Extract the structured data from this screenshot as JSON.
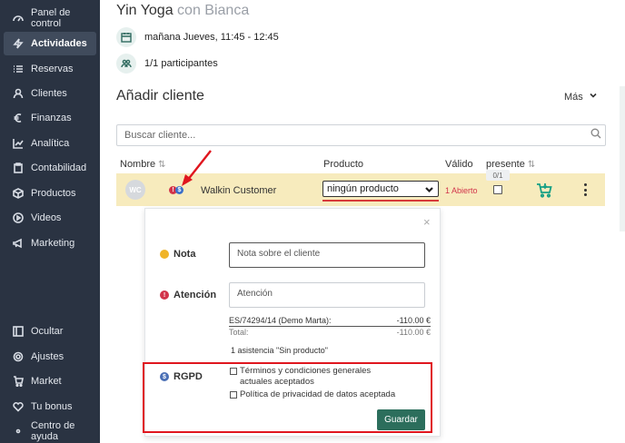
{
  "sidebar": {
    "items": [
      {
        "label": "Panel de control",
        "icon": "gauge-icon",
        "active": false
      },
      {
        "label": "Actividades",
        "icon": "bolt-icon",
        "active": true
      },
      {
        "label": "Reservas",
        "icon": "list-icon",
        "active": false
      },
      {
        "label": "Clientes",
        "icon": "person-icon",
        "active": false
      },
      {
        "label": "Finanzas",
        "icon": "euro-icon",
        "active": false
      },
      {
        "label": "Analítica",
        "icon": "chart-icon",
        "active": false
      },
      {
        "label": "Contabilidad",
        "icon": "clipboard-icon",
        "active": false
      },
      {
        "label": "Productos",
        "icon": "box-icon",
        "active": false
      },
      {
        "label": "Videos",
        "icon": "play-icon",
        "active": false
      },
      {
        "label": "Marketing",
        "icon": "megaphone-icon",
        "active": false
      }
    ],
    "bottom_items": [
      {
        "label": "Ocultar",
        "icon": "collapse-icon"
      },
      {
        "label": "Ajustes",
        "icon": "gear-icon"
      },
      {
        "label": "Market",
        "icon": "cart-icon"
      },
      {
        "label": "Tu bonus",
        "icon": "heart-icon"
      },
      {
        "label": "Centro de ayuda",
        "icon": "dot-icon"
      }
    ]
  },
  "activity": {
    "title": "Yin Yoga",
    "instructor": "con Bianca",
    "schedule": "mañana Jueves, 11:45 - 12:45",
    "participants": "1/1 participantes"
  },
  "add_client": {
    "title": "Añadir cliente",
    "more_label": "Más",
    "search_placeholder": "Buscar cliente..."
  },
  "table": {
    "headers": {
      "name": "Nombre",
      "product": "Producto",
      "valid": "Válido",
      "present": "presente"
    },
    "present_count": "0/1",
    "row": {
      "initials": "WC",
      "name": "Walkin Customer",
      "product": "ningún producto",
      "valid": "1 Abierto",
      "present": false
    }
  },
  "popup": {
    "close": "×",
    "note_label": "Nota",
    "note_placeholder": "Nota sobre el cliente",
    "attention_label": "Atención",
    "attention_placeholder": "Atención",
    "ledger_item": "ES/74294/14 (Demo Marta):",
    "ledger_item_amount": "-110.00 €",
    "total_label": "Total:",
    "total_amount": "-110.00 €",
    "attendance": "1 asistencia \"Sin producto\"",
    "rgpd_label": "RGPD",
    "terms_line1": "Términos y condiciones generales",
    "terms_line2": "actuales aceptados",
    "privacy": "Política de privacidad de datos aceptada",
    "save_label": "Guardar"
  },
  "colors": {
    "sidebar_bg": "#2a3342",
    "row_highlight": "#f7ebbd",
    "accent_green": "#2c6e5c",
    "alert_red": "#d2344b",
    "annotation_red": "#e0161e"
  }
}
